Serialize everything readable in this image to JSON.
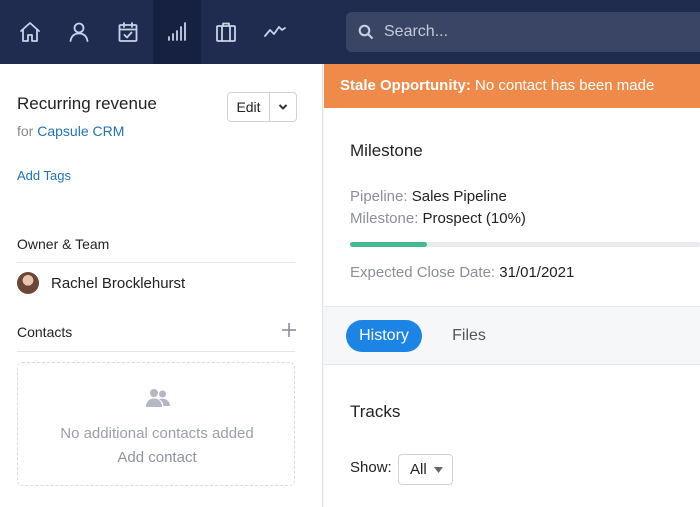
{
  "nav": {
    "icons": [
      "home-icon",
      "person-icon",
      "calendar-check-icon",
      "signal-bars-icon",
      "briefcase-icon",
      "activity-line-icon"
    ],
    "active": "signal-bars-icon"
  },
  "search": {
    "placeholder": "Search..."
  },
  "opportunity": {
    "title": "Recurring revenue",
    "for_prefix": "for",
    "company": "Capsule CRM",
    "edit_label": "Edit",
    "add_tags_label": "Add Tags"
  },
  "owner_section": {
    "heading": "Owner & Team",
    "owner_name": "Rachel Brocklehurst"
  },
  "contacts_section": {
    "heading": "Contacts",
    "empty_text": "No additional contacts added",
    "add_contact_label": "Add contact"
  },
  "banner": {
    "bold": "Stale Opportunity:",
    "text": "No contact has been made",
    "color": "#f08a4b"
  },
  "milestone": {
    "title": "Milestone",
    "pipeline_label": "Pipeline:",
    "pipeline_value": "Sales Pipeline",
    "milestone_label": "Milestone:",
    "milestone_value": "Prospect (10%)",
    "progress_fraction": 0.22,
    "close_label": "Expected Close Date:",
    "close_value": "31/01/2021"
  },
  "tabs": [
    {
      "label": "History",
      "active": true
    },
    {
      "label": "Files",
      "active": false
    }
  ],
  "tracks": {
    "title": "Tracks",
    "show_label": "Show:",
    "show_value": "All"
  },
  "colors": {
    "topbar": "#1f2b4f",
    "accent": "#1b84e4",
    "link": "#1f73b7",
    "progress": "#45b98f"
  }
}
